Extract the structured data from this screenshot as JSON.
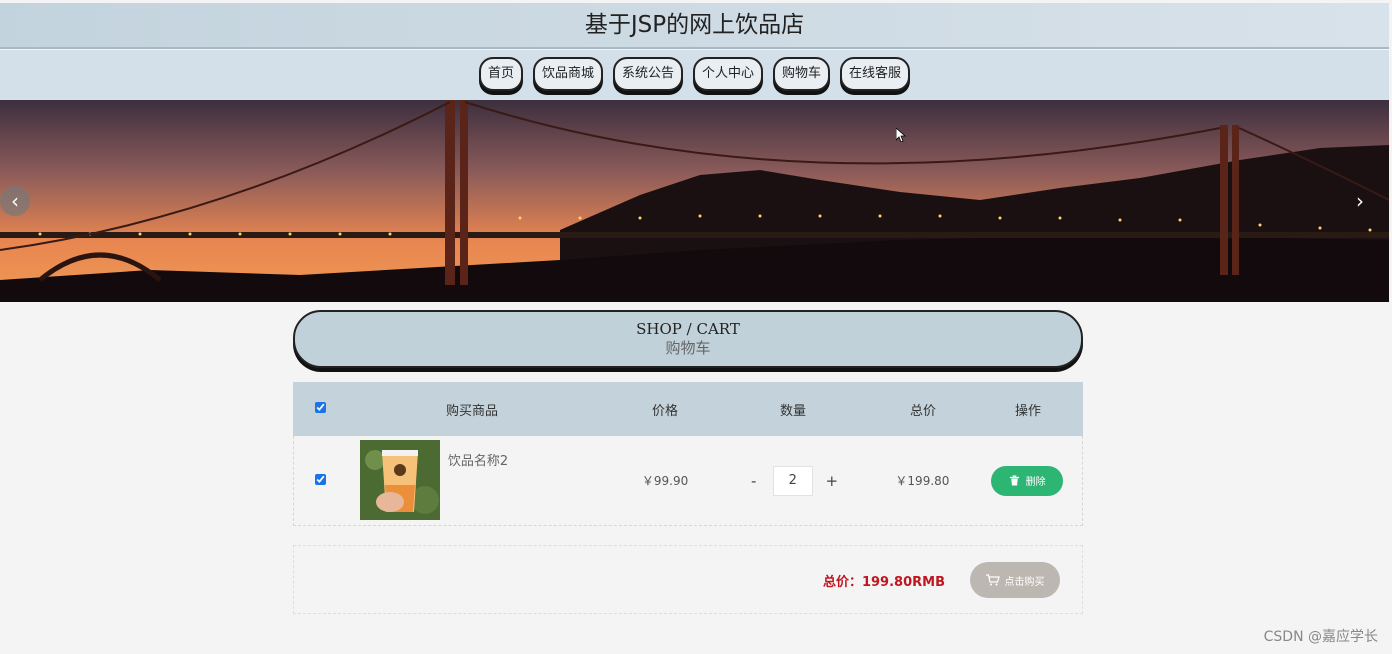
{
  "header": {
    "title": "基于JSP的网上饮品店"
  },
  "nav": {
    "items": [
      {
        "label": "首页"
      },
      {
        "label": "饮品商城"
      },
      {
        "label": "系统公告"
      },
      {
        "label": "个人中心"
      },
      {
        "label": "购物车"
      },
      {
        "label": "在线客服"
      }
    ]
  },
  "banner": {
    "prev_icon": "chevron-left-icon",
    "next_icon": "chevron-right-icon"
  },
  "section": {
    "title_en": "SHOP / CART",
    "title_cn": "购物车"
  },
  "cart": {
    "columns": {
      "goods": "购买商品",
      "price": "价格",
      "quantity": "数量",
      "total": "总价",
      "action": "操作"
    },
    "select_all_checked": true,
    "items": [
      {
        "checked": true,
        "name": "饮品名称2",
        "price": "￥99.90",
        "minus": "-",
        "quantity": "2",
        "plus": "+",
        "total": "￥199.80",
        "delete_label": "删除",
        "delete_icon": "trash-icon"
      }
    ],
    "summary": "总价：199.80RMB",
    "buy_label": "点击购买",
    "buy_icon": "cart-icon"
  },
  "watermark": "CSDN @嘉应学长",
  "colors": {
    "header_bg": "#c3d3dd",
    "nav_bg": "#d3e0ea",
    "table_header_bg": "#c4d3db",
    "delete_button": "#2db574",
    "total_text": "#c0161f",
    "buy_button": "#bdb7b2"
  }
}
